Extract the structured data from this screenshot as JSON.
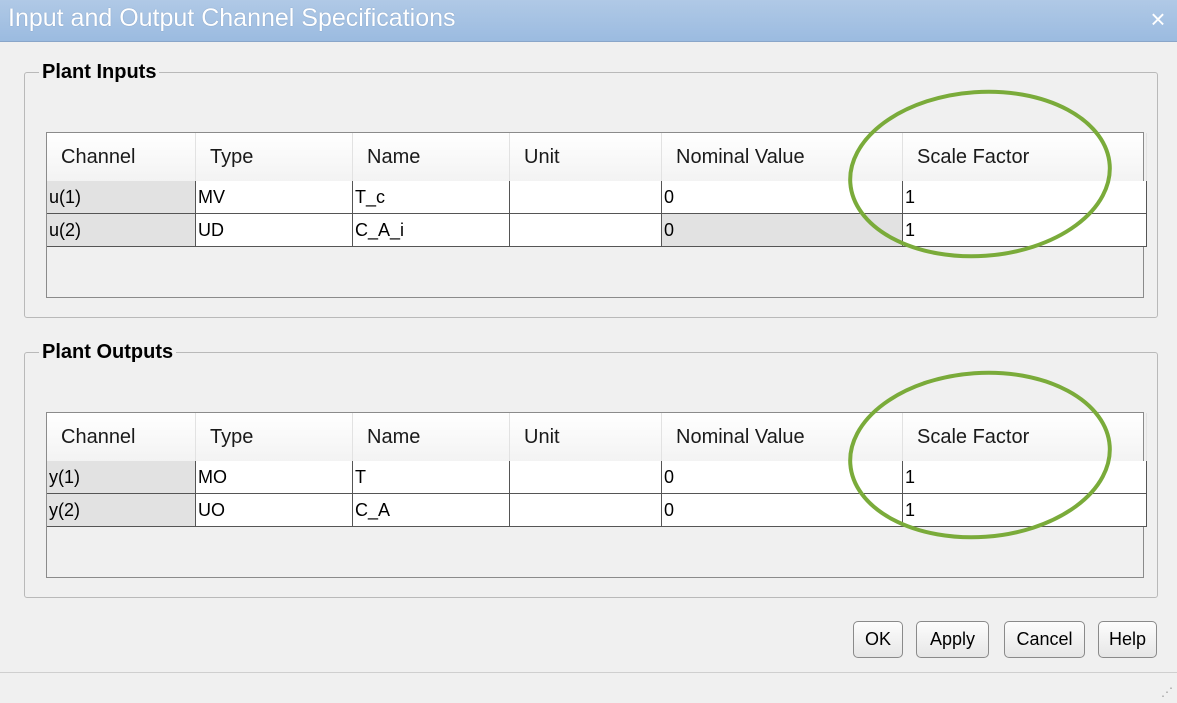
{
  "window": {
    "title": "Input and Output Channel Specifications",
    "close_glyph": "×"
  },
  "inputs": {
    "legend": "Plant Inputs",
    "headers": [
      "Channel",
      "Type",
      "Name",
      "Unit",
      "Nominal Value",
      "Scale Factor"
    ],
    "rows": [
      {
        "channel": "u(1)",
        "type": "MV",
        "name": "T_c",
        "unit": "",
        "nominal": "0",
        "scale": "1"
      },
      {
        "channel": "u(2)",
        "type": "UD",
        "name": "C_A_i",
        "unit": "",
        "nominal": "0",
        "scale": "1"
      }
    ]
  },
  "outputs": {
    "legend": "Plant Outputs",
    "headers": [
      "Channel",
      "Type",
      "Name",
      "Unit",
      "Nominal Value",
      "Scale Factor"
    ],
    "rows": [
      {
        "channel": "y(1)",
        "type": "MO",
        "name": "T",
        "unit": "",
        "nominal": "0",
        "scale": "1"
      },
      {
        "channel": "y(2)",
        "type": "UO",
        "name": "C_A",
        "unit": "",
        "nominal": "0",
        "scale": "1"
      }
    ]
  },
  "buttons": {
    "ok": "OK",
    "apply": "Apply",
    "cancel": "Cancel",
    "help": "Help"
  },
  "colors": {
    "highlight": "#7aab3a",
    "titlebar": "#9bbbe0"
  },
  "icons": {
    "close": "close-icon",
    "grip": "resize-grip-icon"
  }
}
